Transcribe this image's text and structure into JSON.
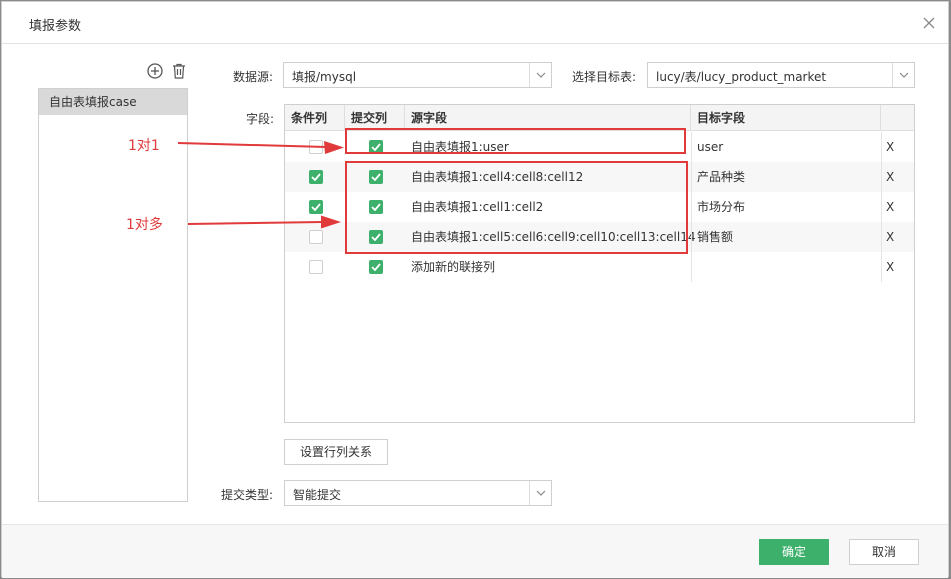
{
  "dialog": {
    "title": "填报参数"
  },
  "left_panel": {
    "items": [
      {
        "label": "自由表填报case"
      }
    ]
  },
  "form": {
    "datasource_label": "数据源:",
    "datasource_value": "填报/mysql",
    "target_label": "选择目标表:",
    "target_value": "lucy/表/lucy_product_market",
    "fields_label": "字段:",
    "submit_type_label": "提交类型:",
    "submit_type_value": "智能提交",
    "set_relation_button": "设置行列关系"
  },
  "table": {
    "headers": [
      "条件列",
      "提交列",
      "源字段",
      "目标字段"
    ],
    "rows": [
      {
        "condition": false,
        "submit": true,
        "source": "自由表填报1:user",
        "target": "user",
        "delete": "X"
      },
      {
        "condition": true,
        "submit": true,
        "source": "自由表填报1:cell4:cell8:cell12",
        "target": "产品种类",
        "delete": "X"
      },
      {
        "condition": true,
        "submit": true,
        "source": "自由表填报1:cell1:cell2",
        "target": "市场分布",
        "delete": "X"
      },
      {
        "condition": false,
        "submit": true,
        "source": "自由表填报1:cell5:cell6:cell9:cell10:cell13:cell14",
        "target": "销售额",
        "delete": "X"
      },
      {
        "condition": false,
        "submit": true,
        "source": "添加新的联接列",
        "target": "",
        "delete": "X"
      }
    ]
  },
  "annotations": {
    "one_to_one": "1对1",
    "one_to_many": "1对多"
  },
  "footer": {
    "confirm": "确定",
    "cancel": "取消"
  },
  "colors": {
    "accent": "#3db16b",
    "annotation": "#e03a3a"
  }
}
